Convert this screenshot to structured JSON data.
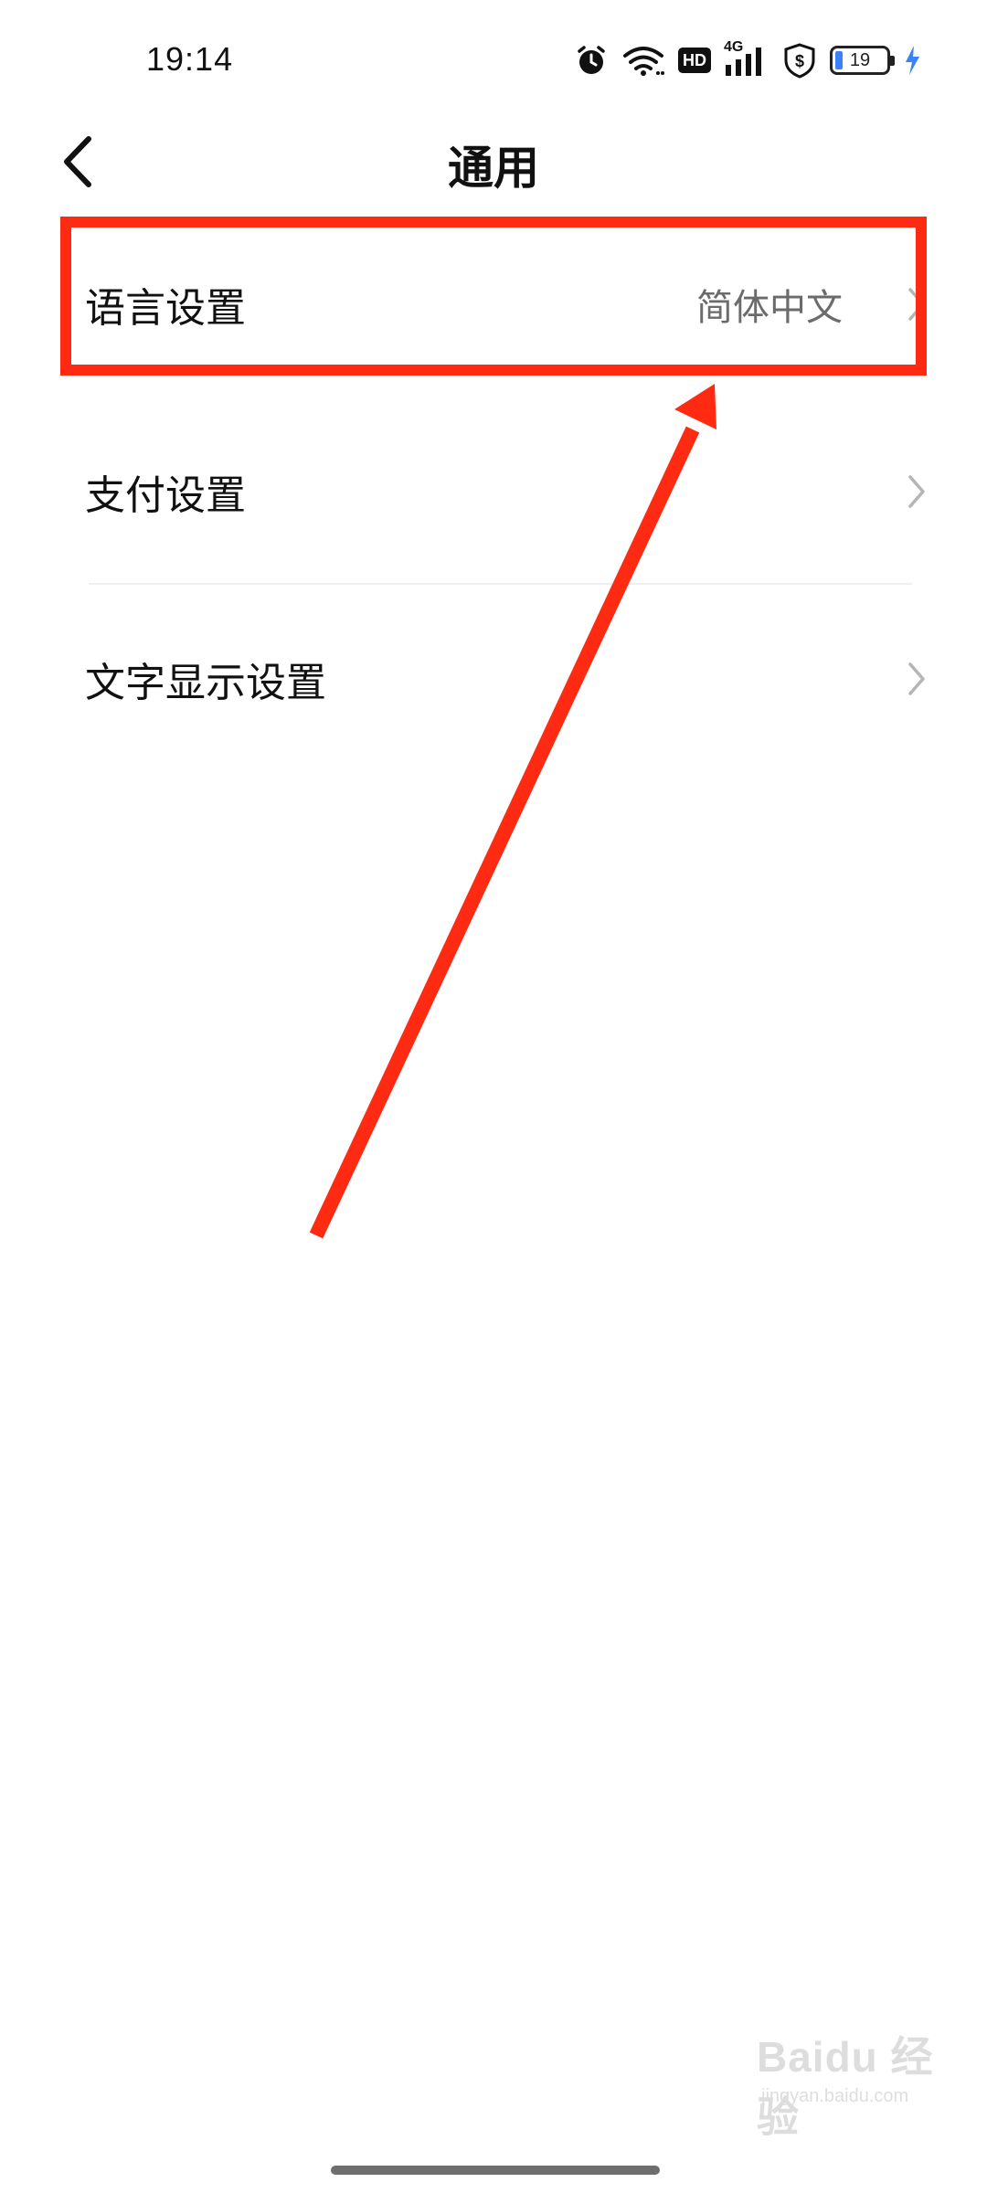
{
  "status_bar": {
    "time": "19:14",
    "network": "4G",
    "hd": "HD",
    "battery": "19",
    "icons": [
      "alarm-icon",
      "wifi-icon",
      "hd-icon",
      "signal-icon",
      "shield-dollar-icon",
      "battery-icon",
      "charging-icon"
    ]
  },
  "header": {
    "title": "通用",
    "back_icon": "chevron-left-icon"
  },
  "settings": {
    "items": [
      {
        "label": "语言设置",
        "value": "简体中文"
      },
      {
        "label": "支付设置",
        "value": ""
      },
      {
        "label": "文字显示设置",
        "value": ""
      }
    ]
  },
  "annotation": {
    "color": "#ff2a12",
    "highlighted_item": "语言设置"
  },
  "watermark": {
    "brand": "Baidu 经验",
    "url": "jingyan.baidu.com"
  }
}
